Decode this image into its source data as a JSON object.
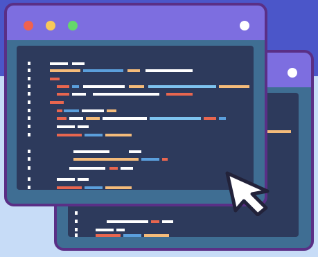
{
  "colors": {
    "background_top": "#4b56c9",
    "background_bottom": "#c7dcf7",
    "window_border": "#5a2f86",
    "titlebar": "#7d6ee0",
    "window_frame": "#3f6e93",
    "code_panel": "#2d3a5c",
    "dot_red": "#f0624f",
    "dot_yellow": "#f7c85a",
    "dot_green": "#65d86b",
    "dot_white": "#ffffff",
    "code_white": "#ffffff",
    "code_blue": "#5b9fdc",
    "code_orange": "#f4bb7a",
    "code_red": "#e8664f",
    "code_skyblue": "#7ec3ef",
    "cursor_fill": "#ffffff",
    "cursor_outline": "#22223a"
  },
  "icons": {
    "front_window_controls": [
      "close-dot",
      "minimize-dot",
      "maximize-dot",
      "menu-dot"
    ],
    "back_window_controls": [
      "menu-dot"
    ],
    "pointer": "mouse-cursor-arrow"
  }
}
